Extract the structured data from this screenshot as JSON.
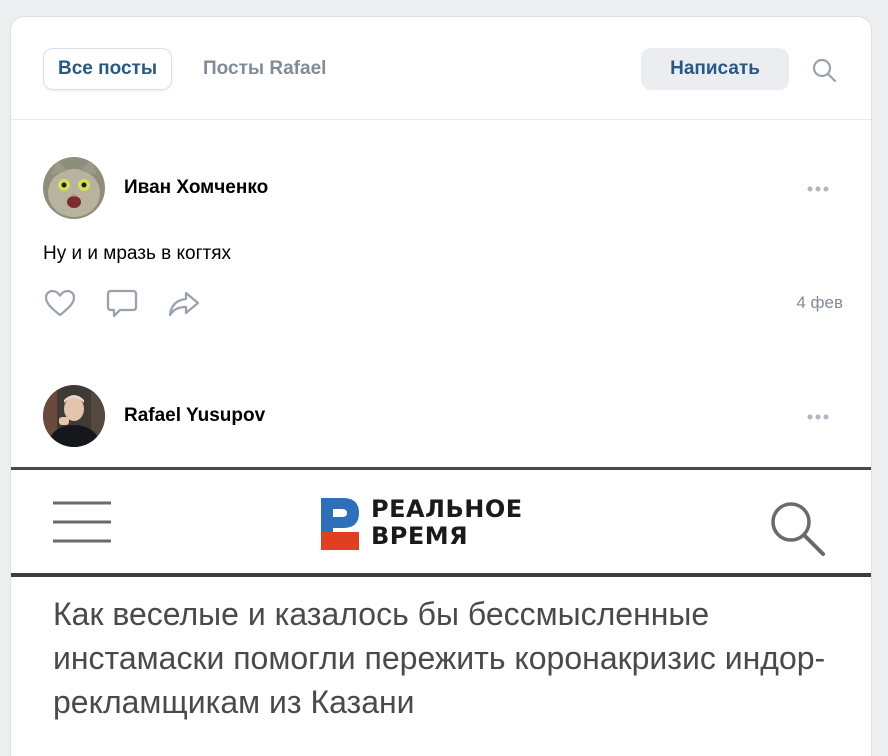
{
  "tabs": {
    "all_posts": "Все посты",
    "user_posts": "Посты Rafael"
  },
  "toolbar": {
    "write_label": "Написать",
    "search_icon": "search-icon"
  },
  "posts": [
    {
      "author": "Иван Хомченко",
      "text": "Ну и и мразь в когтях",
      "date": "4 фев",
      "actions": [
        "heart-icon",
        "comment-icon",
        "share-icon"
      ]
    },
    {
      "author": "Rafael Yusupov"
    }
  ],
  "embed": {
    "logo_line1": "РЕАЛЬНОЕ",
    "logo_line2": "ВРЕМЯ",
    "headline": "Как веселые и казалось бы бессмысленные инстамаски помогли пережить коронакризис индор-рекламщикам из Казани"
  },
  "colors": {
    "accent": "#2a5885",
    "muted": "#818c99",
    "logo_blue": "#2d6fb8",
    "logo_red": "#e0401f"
  }
}
